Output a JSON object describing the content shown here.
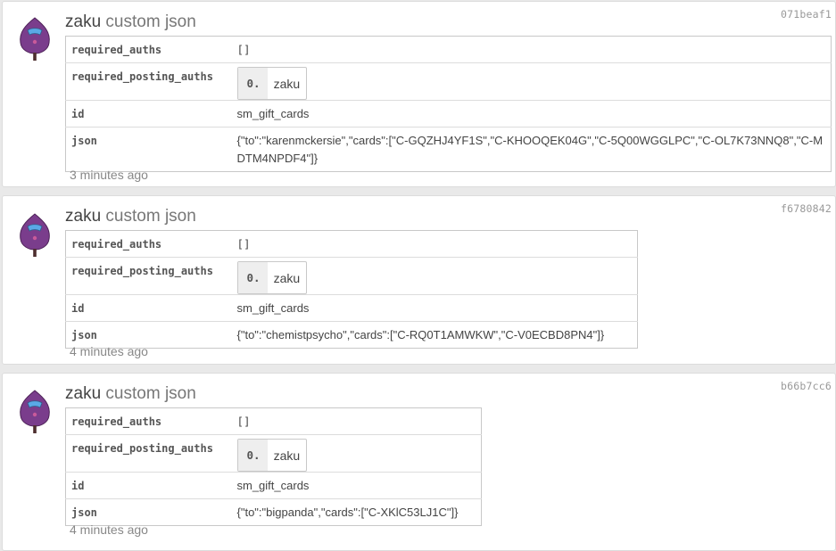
{
  "operations": [
    {
      "user": "zaku",
      "op_type": "custom json",
      "hash": "071beaf1",
      "fields": {
        "required_auths_label": "required_auths",
        "required_auths_value": "[]",
        "required_posting_auths_label": "required_posting_auths",
        "posting_auth_index": "0.",
        "posting_auth_name": "zaku",
        "id_label": "id",
        "id_value": "sm_gift_cards",
        "json_label": "json",
        "json_value": "{\"to\":\"karenmckersie\",\"cards\":[\"C-GQZHJ4YF1S\",\"C-KHOOQEK04G\",\"C-5Q00WGGLPC\",\"C-OL7K73NNQ8\",\"C-MDTM4NPDF4\"]}"
      },
      "time": "3 minutes ago"
    },
    {
      "user": "zaku",
      "op_type": "custom json",
      "hash": "f6780842",
      "fields": {
        "required_auths_label": "required_auths",
        "required_auths_value": "[]",
        "required_posting_auths_label": "required_posting_auths",
        "posting_auth_index": "0.",
        "posting_auth_name": "zaku",
        "id_label": "id",
        "id_value": "sm_gift_cards",
        "json_label": "json",
        "json_value": "{\"to\":\"chemistpsycho\",\"cards\":[\"C-RQ0T1AMWKW\",\"C-V0ECBD8PN4\"]}"
      },
      "time": "4 minutes ago"
    },
    {
      "user": "zaku",
      "op_type": "custom json",
      "hash": "b66b7cc6",
      "fields": {
        "required_auths_label": "required_auths",
        "required_auths_value": "[]",
        "required_posting_auths_label": "required_posting_auths",
        "posting_auth_index": "0.",
        "posting_auth_name": "zaku",
        "id_label": "id",
        "id_value": "sm_gift_cards",
        "json_label": "json",
        "json_value": "{\"to\":\"bigpanda\",\"cards\":[\"C-XKlC53LJ1C\"]}"
      },
      "time": "4 minutes ago"
    }
  ],
  "colors": {
    "avatar_body": "#7a3d8c",
    "avatar_visor": "#5aa9e6"
  }
}
